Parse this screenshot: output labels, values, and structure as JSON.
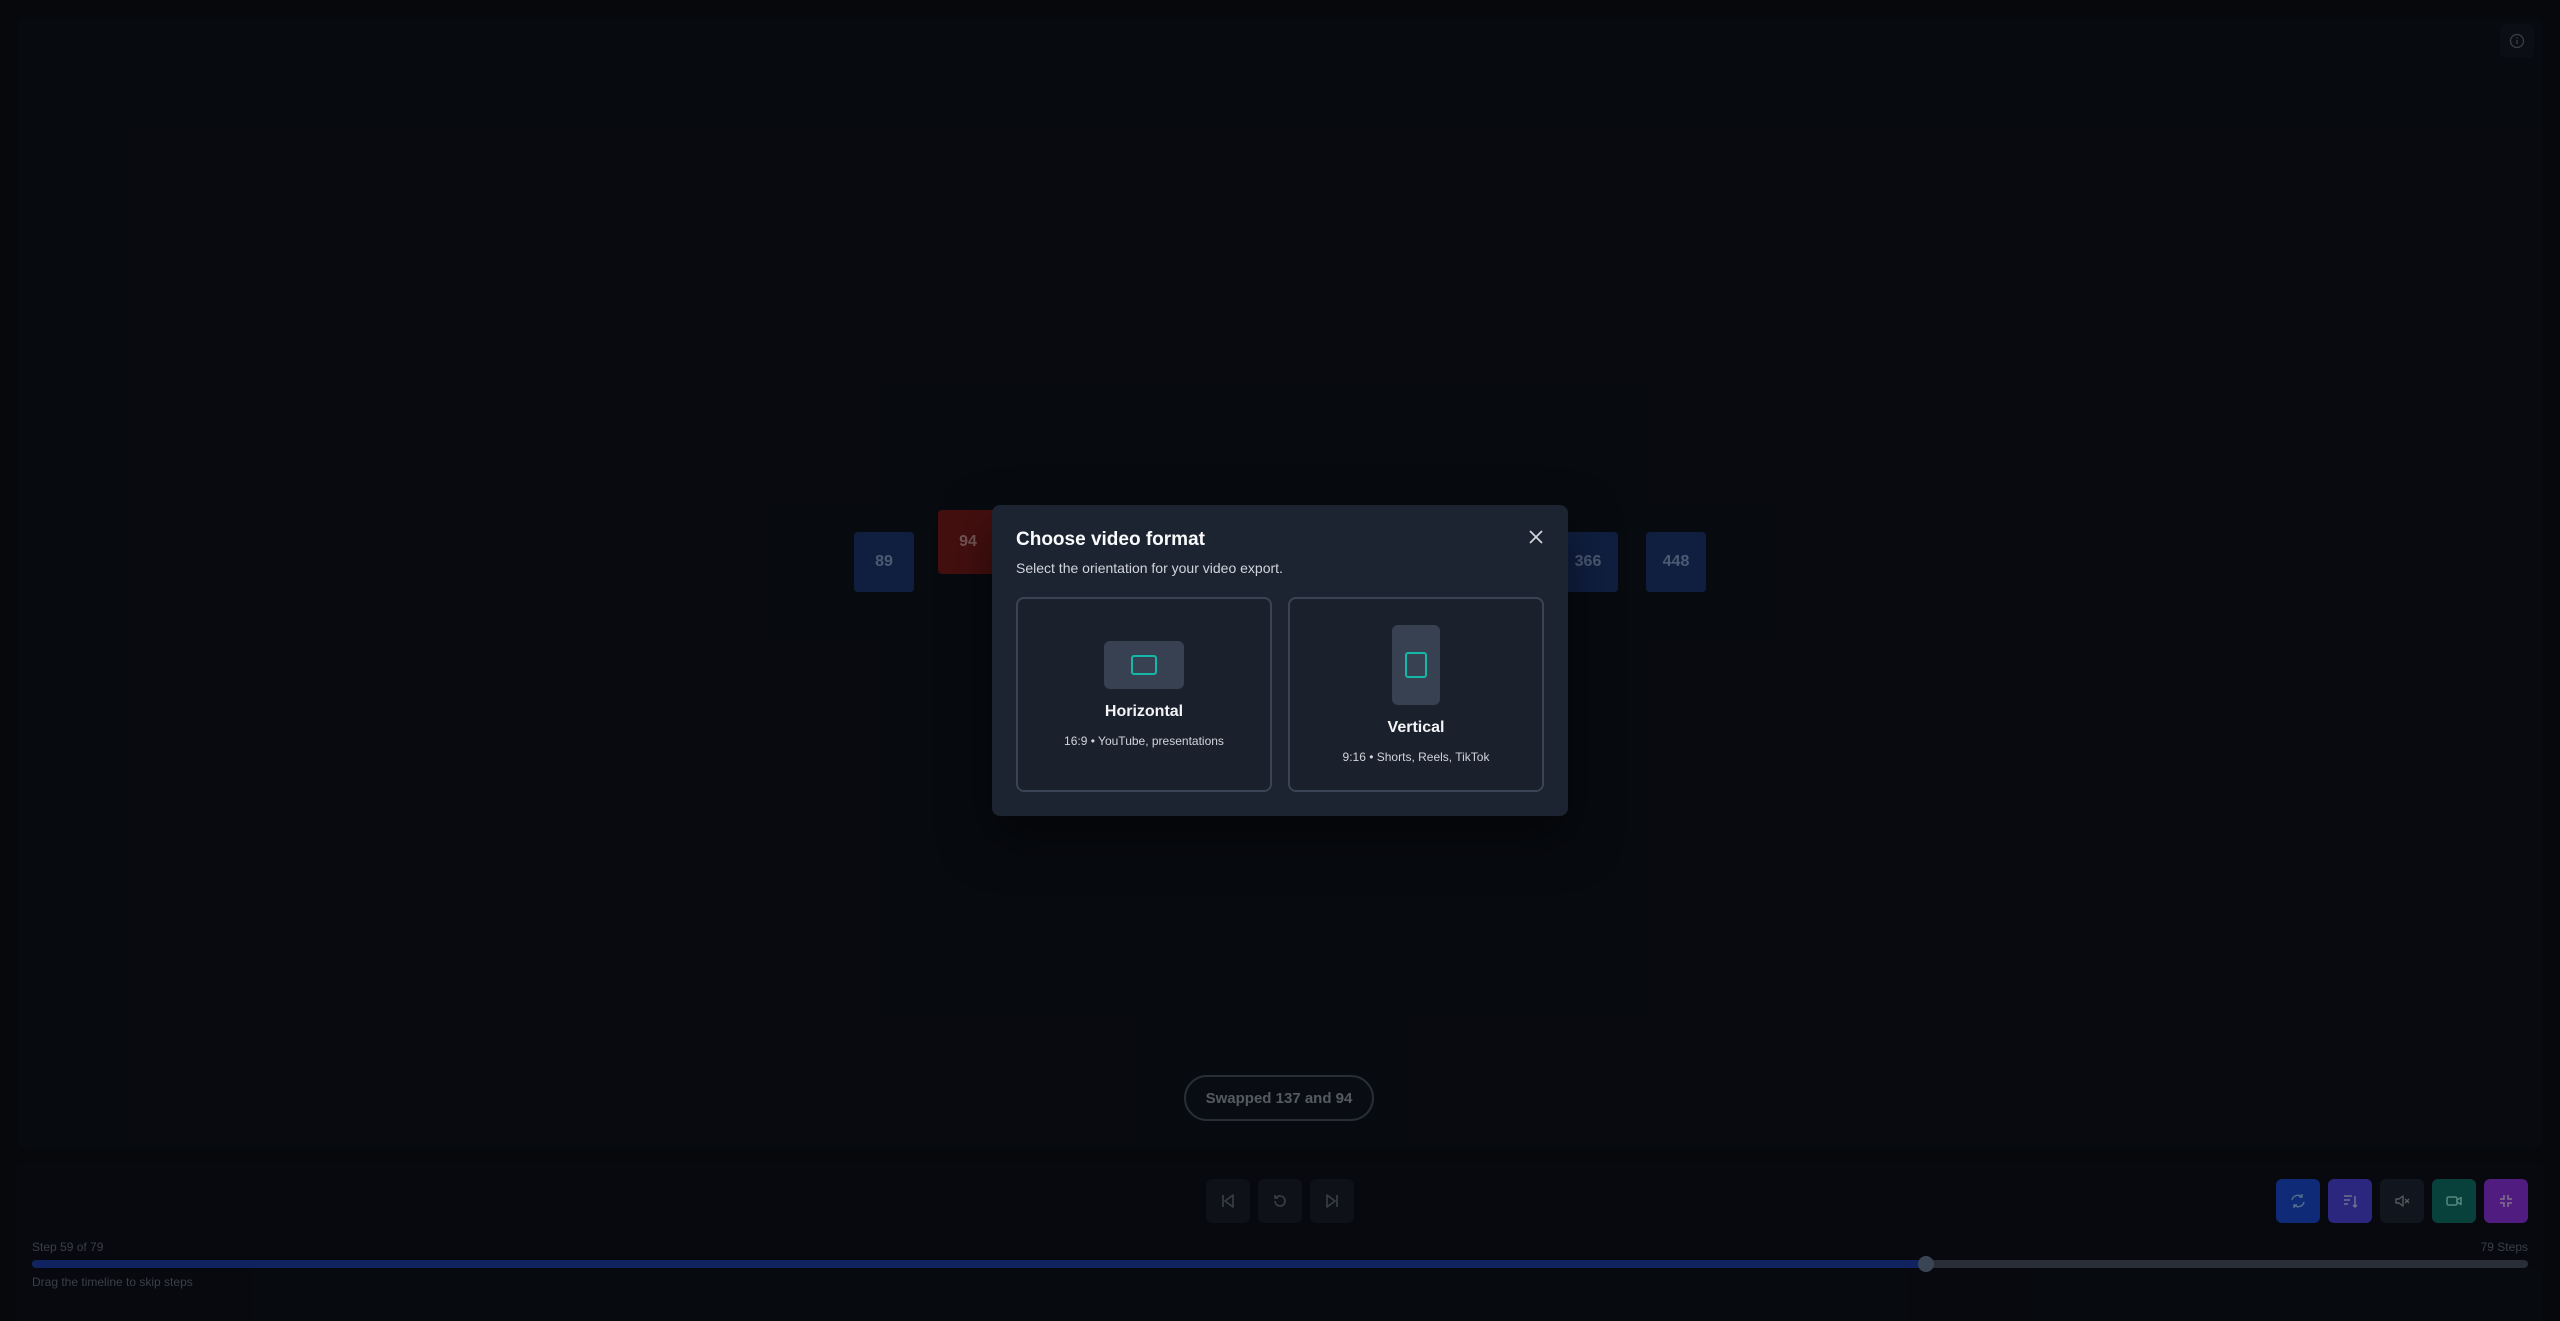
{
  "visualization": {
    "bars": [
      {
        "value": "89",
        "state": "default"
      },
      {
        "value": "94",
        "state": "swapping"
      },
      {
        "value": "366",
        "state": "default"
      },
      {
        "value": "448",
        "state": "default"
      }
    ],
    "status_message": "Swapped 137 and 94"
  },
  "modal": {
    "title": "Choose video format",
    "subtitle": "Select the orientation for your video export.",
    "options": [
      {
        "label": "Horizontal",
        "description": "16:9 • YouTube, presentations"
      },
      {
        "label": "Vertical",
        "description": "9:16 • Shorts, Reels, TikTok"
      }
    ]
  },
  "timeline": {
    "step_label": "Step 59 of 79",
    "steps_total_label": "79 Steps",
    "hint": "Drag the timeline to skip steps",
    "progress_fraction": 0.759
  },
  "controls": {
    "playback": [
      "skip-back-icon",
      "reset-icon",
      "skip-forward-icon"
    ],
    "tools": [
      {
        "icon": "shuffle-icon",
        "color": "#1d4ed8"
      },
      {
        "icon": "sort-icon",
        "color": "#4f46e5"
      },
      {
        "icon": "mute-icon",
        "color": "#1f2937"
      },
      {
        "icon": "video-icon",
        "color": "#0f766e"
      },
      {
        "icon": "exit-fullscreen-icon",
        "color": "#9333ea"
      }
    ]
  },
  "colors": {
    "accent": "#14b8a6",
    "bar_default": "#1e3a76",
    "bar_swap": "#7c1d1d"
  }
}
